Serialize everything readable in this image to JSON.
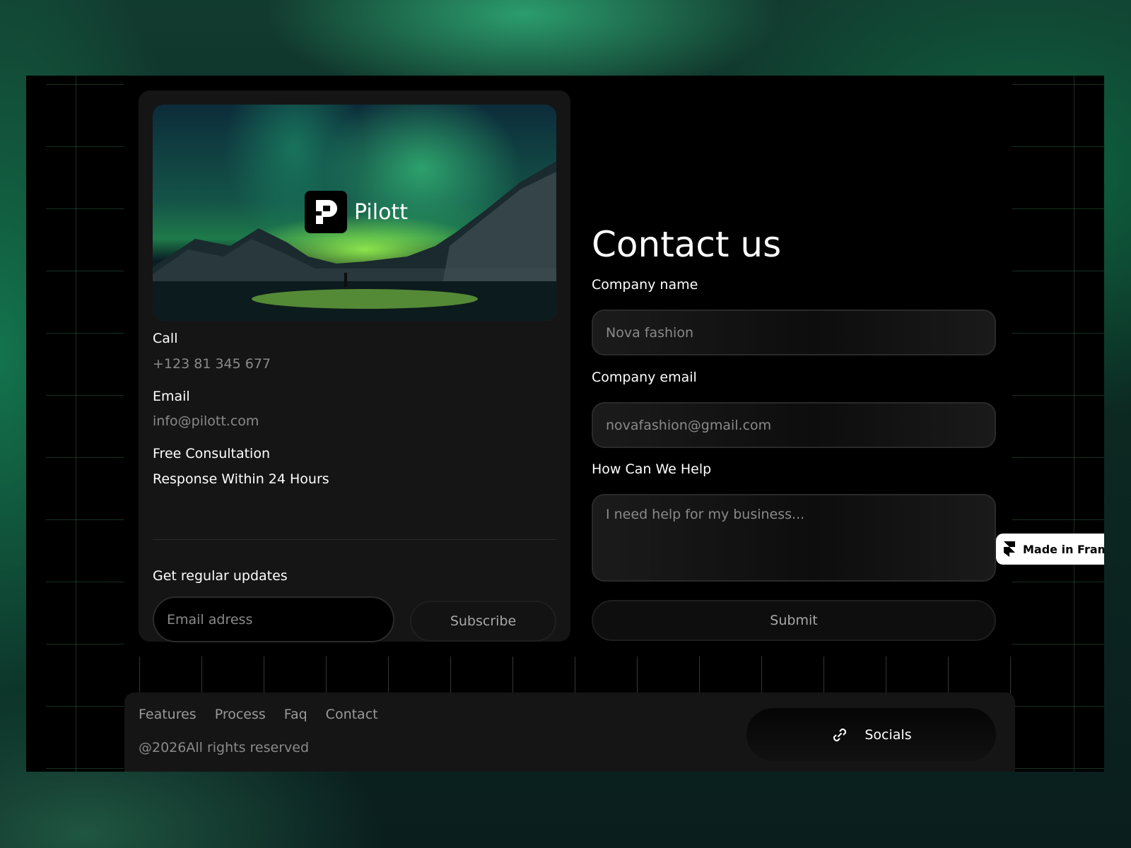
{
  "brand": {
    "name": "Pilott"
  },
  "contact_info": {
    "call_label": "Call",
    "call_value": "+123 81 345 677",
    "email_label": "Email",
    "email_value": "info@pilott.com",
    "consultation_label": "Free Consultation",
    "response_label": "Response Within 24 Hours"
  },
  "newsletter": {
    "label": "Get regular updates",
    "input_placeholder": "Email adress",
    "button_label": "Subscribe"
  },
  "form": {
    "title": "Contact us",
    "company_name_label": "Company name",
    "company_name_placeholder": "Nova fashion",
    "company_email_label": "Company email",
    "company_email_placeholder": "novafashion@gmail.com",
    "help_label": "How Can We Help",
    "help_placeholder": "I need help for my business...",
    "submit_label": "Submit"
  },
  "badge": {
    "label": "Made in Framer"
  },
  "footer": {
    "links": [
      "Features",
      "Process",
      "Faq",
      "Contact"
    ],
    "copyright": "@2026All rights reserved",
    "socials_label": "Socials"
  },
  "colors": {
    "accent_green": "#1e7a4a",
    "card_bg": "#151515",
    "muted_text": "#8a8a8a"
  }
}
